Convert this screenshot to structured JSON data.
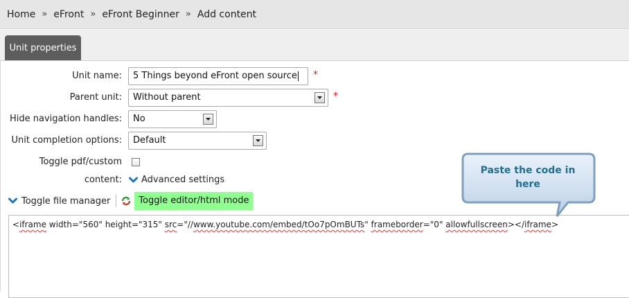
{
  "breadcrumb": {
    "items": [
      "Home",
      "eFront",
      "eFront Beginner",
      "Add content"
    ],
    "separator": "»"
  },
  "tab": {
    "label": "Unit properties"
  },
  "form": {
    "unit_name": {
      "label": "Unit name:",
      "value": "5 Things beyond eFront open source",
      "required_mark": "*"
    },
    "parent_unit": {
      "label": "Parent unit:",
      "selected": "Without parent",
      "required_mark": "*"
    },
    "hide_navigation": {
      "label": "Hide navigation handles:",
      "selected": "No"
    },
    "completion_options": {
      "label": "Unit completion options:",
      "selected": "Default"
    },
    "toggle_pdf": {
      "label": "Toggle pdf/custom content:",
      "checked": false
    },
    "advanced_settings": {
      "label": "Advanced settings"
    }
  },
  "toolbar": {
    "file_manager_label": "Toggle file manager",
    "editor_mode_label": "Toggle editor/html mode"
  },
  "editor": {
    "parts": [
      {
        "t": "<",
        "sq": false
      },
      {
        "t": "iframe",
        "sq": true
      },
      {
        "t": " width=\"560\" height=\"315\" ",
        "sq": false
      },
      {
        "t": "src",
        "sq": true
      },
      {
        "t": "=\"//",
        "sq": false
      },
      {
        "t": "www.youtube.com/embed/tOo7pOmBUTs",
        "sq": true
      },
      {
        "t": "\" ",
        "sq": false
      },
      {
        "t": "frameborder",
        "sq": true
      },
      {
        "t": "=\"0\" ",
        "sq": false
      },
      {
        "t": "allowfullscreen",
        "sq": true
      },
      {
        "t": "></",
        "sq": false
      },
      {
        "t": "iframe",
        "sq": true
      },
      {
        "t": ">",
        "sq": false
      }
    ]
  },
  "callout": {
    "line1": "Paste the code in",
    "line2": "here"
  },
  "colors": {
    "tab_bg": "#5d5d5d",
    "highlight": "#8fff8f",
    "chevron": "#1e73be",
    "required": "#dd2222",
    "callout_text": "#1f6f8f"
  }
}
